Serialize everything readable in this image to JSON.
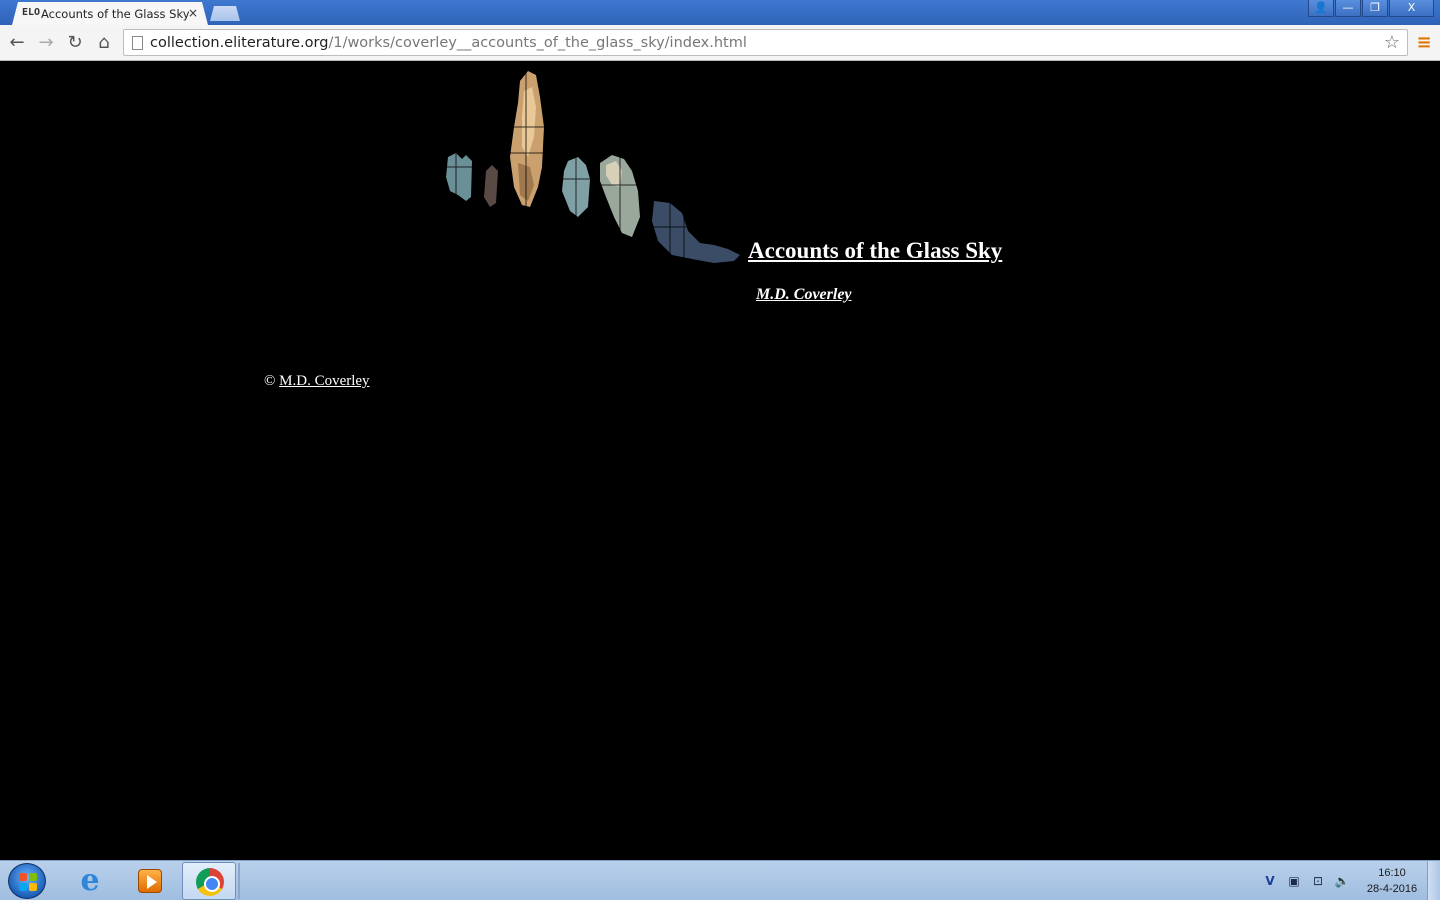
{
  "browser": {
    "tab": {
      "favicon": "ELO",
      "title": "Accounts of the Glass Sky",
      "close_glyph": "×"
    },
    "window_controls": {
      "user": "👤",
      "minimize": "—",
      "restore": "❐",
      "close": "X"
    },
    "nav": {
      "back": "←",
      "forward": "→",
      "reload": "↻",
      "home": "⌂"
    },
    "omnibox": {
      "url_host": "collection.eliterature.org",
      "url_path": "/1/works/coverley__accounts_of_the_glass_sky/index.html",
      "star": "☆"
    },
    "menu_glyph": "≡"
  },
  "page": {
    "title": "Accounts of the Glass Sky",
    "author": "M.D. Coverley",
    "copyright_symbol": "©",
    "copyright_name": "M.D. Coverley"
  },
  "taskbar": {
    "apps": [
      "internet-explorer",
      "windows-media-player",
      "google-chrome"
    ],
    "active_app": "google-chrome",
    "ie_glyph": "e",
    "tray": {
      "shield": "V",
      "monitor": "▣",
      "network": "⊡",
      "volume": "🔈"
    },
    "clock": {
      "time": "16:10",
      "date": "28-4-2016"
    }
  }
}
